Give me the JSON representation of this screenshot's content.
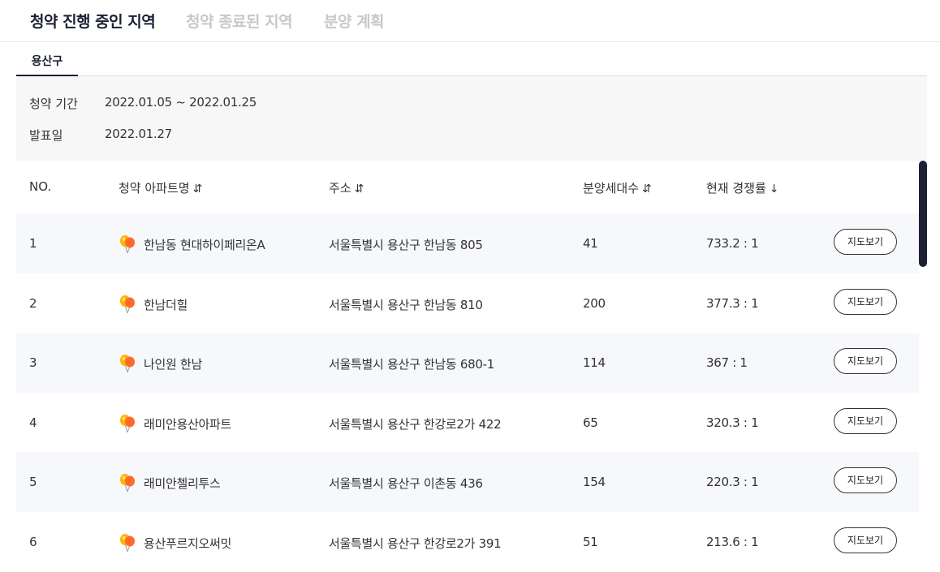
{
  "top_tabs": [
    {
      "label": "청약 진행 중인 지역",
      "active": true
    },
    {
      "label": "청약 종료된 지역",
      "active": false
    },
    {
      "label": "분양 계획",
      "active": false
    }
  ],
  "region_tab": {
    "label": "용산구"
  },
  "info": {
    "period_label": "청약 기간",
    "period_value": "2022.01.05 ~ 2022.01.25",
    "announce_label": "발표일",
    "announce_value": "2022.01.27"
  },
  "table": {
    "headers": {
      "no": "NO.",
      "name": "청약 아파트명",
      "address": "주소",
      "units": "분양세대수",
      "rate": "현재 경쟁률"
    },
    "sort_icons": {
      "name": "⇵",
      "address": "⇵",
      "units": "⇵",
      "rate": "↓"
    },
    "map_button_label": "지도보기",
    "rows": [
      {
        "no": "1",
        "name": "한남동 현대하이페리온A",
        "address": "서울특별시 용산구 한남동 805",
        "units": "41",
        "rate": "733.2 : 1"
      },
      {
        "no": "2",
        "name": "한남더힐",
        "address": "서울특별시 용산구 한남동 810",
        "units": "200",
        "rate": "377.3 : 1"
      },
      {
        "no": "3",
        "name": "나인원 한남",
        "address": "서울특별시 용산구 한남동 680-1",
        "units": "114",
        "rate": "367 : 1"
      },
      {
        "no": "4",
        "name": "래미안용산아파트",
        "address": "서울특별시 용산구 한강로2가 422",
        "units": "65",
        "rate": "320.3 : 1"
      },
      {
        "no": "5",
        "name": "래미안첼리투스",
        "address": "서울특별시 용산구 이촌동 436",
        "units": "154",
        "rate": "220.3 : 1"
      },
      {
        "no": "6",
        "name": "용산푸르지오써밋",
        "address": "서울특별시 용산구 한강로2가 391",
        "units": "51",
        "rate": "213.6 : 1"
      }
    ]
  },
  "icons": {
    "apartment": "balloon-icon"
  },
  "colors": {
    "navy": "#1b2033",
    "inactive_tab": "#c8c8c8",
    "row_alt": "#f6f8fb"
  }
}
